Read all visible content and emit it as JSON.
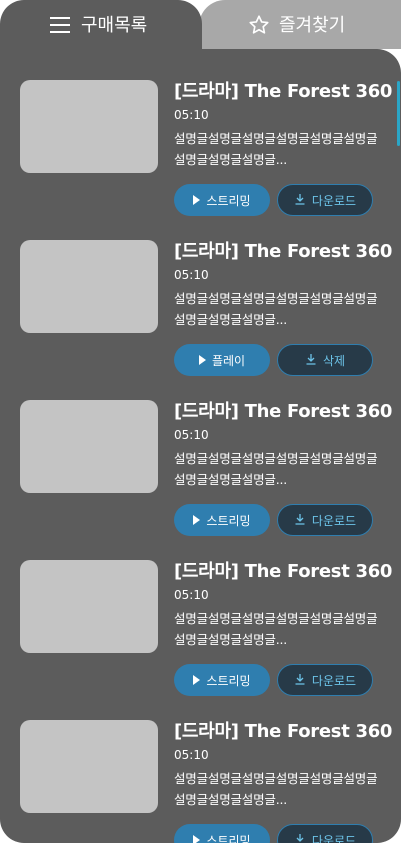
{
  "tabs": {
    "purchase_label": "구매목록",
    "favorites_label": "즐겨찾기"
  },
  "items": [
    {
      "title": "[드라마] The Forest 360",
      "duration": "05:10",
      "description": "설명글설명글설명글설명글설명글설명글설명글설명글설명글...",
      "primary_label": "스트리밍",
      "secondary_label": "다운로드"
    },
    {
      "title": "[드라마] The Forest 360",
      "duration": "05:10",
      "description": "설명글설명글설명글설명글설명글설명글설명글설명글설명글...",
      "primary_label": "플레이",
      "secondary_label": "삭제"
    },
    {
      "title": "[드라마] The Forest 360",
      "duration": "05:10",
      "description": "설명글설명글설명글설명글설명글설명글설명글설명글설명글...",
      "primary_label": "스트리밍",
      "secondary_label": "다운로드"
    },
    {
      "title": "[드라마] The Forest 360",
      "duration": "05:10",
      "description": "설명글설명글설명글설명글설명글설명글설명글설명글설명글...",
      "primary_label": "스트리밍",
      "secondary_label": "다운로드"
    },
    {
      "title": "[드라마] The Forest 360",
      "duration": "05:10",
      "description": "설명글설명글설명글설명글설명글설명글설명글설명글설명글...",
      "primary_label": "스트리밍",
      "secondary_label": "다운로드"
    }
  ],
  "colors": {
    "panel_bg": "#5c5c5c",
    "inactive_tab_bg": "#a8a8a8",
    "primary_button": "#2f7eaf",
    "secondary_button": "#273a48",
    "accent_text": "#6cc3e8",
    "scrollbar": "#2aa6c7",
    "thumbnail_placeholder": "#c4c4c4"
  },
  "icons": {
    "purchase_tab": "menu-icon",
    "favorites_tab": "star-icon",
    "primary_button": "play-icon",
    "secondary_button": "download-icon"
  }
}
